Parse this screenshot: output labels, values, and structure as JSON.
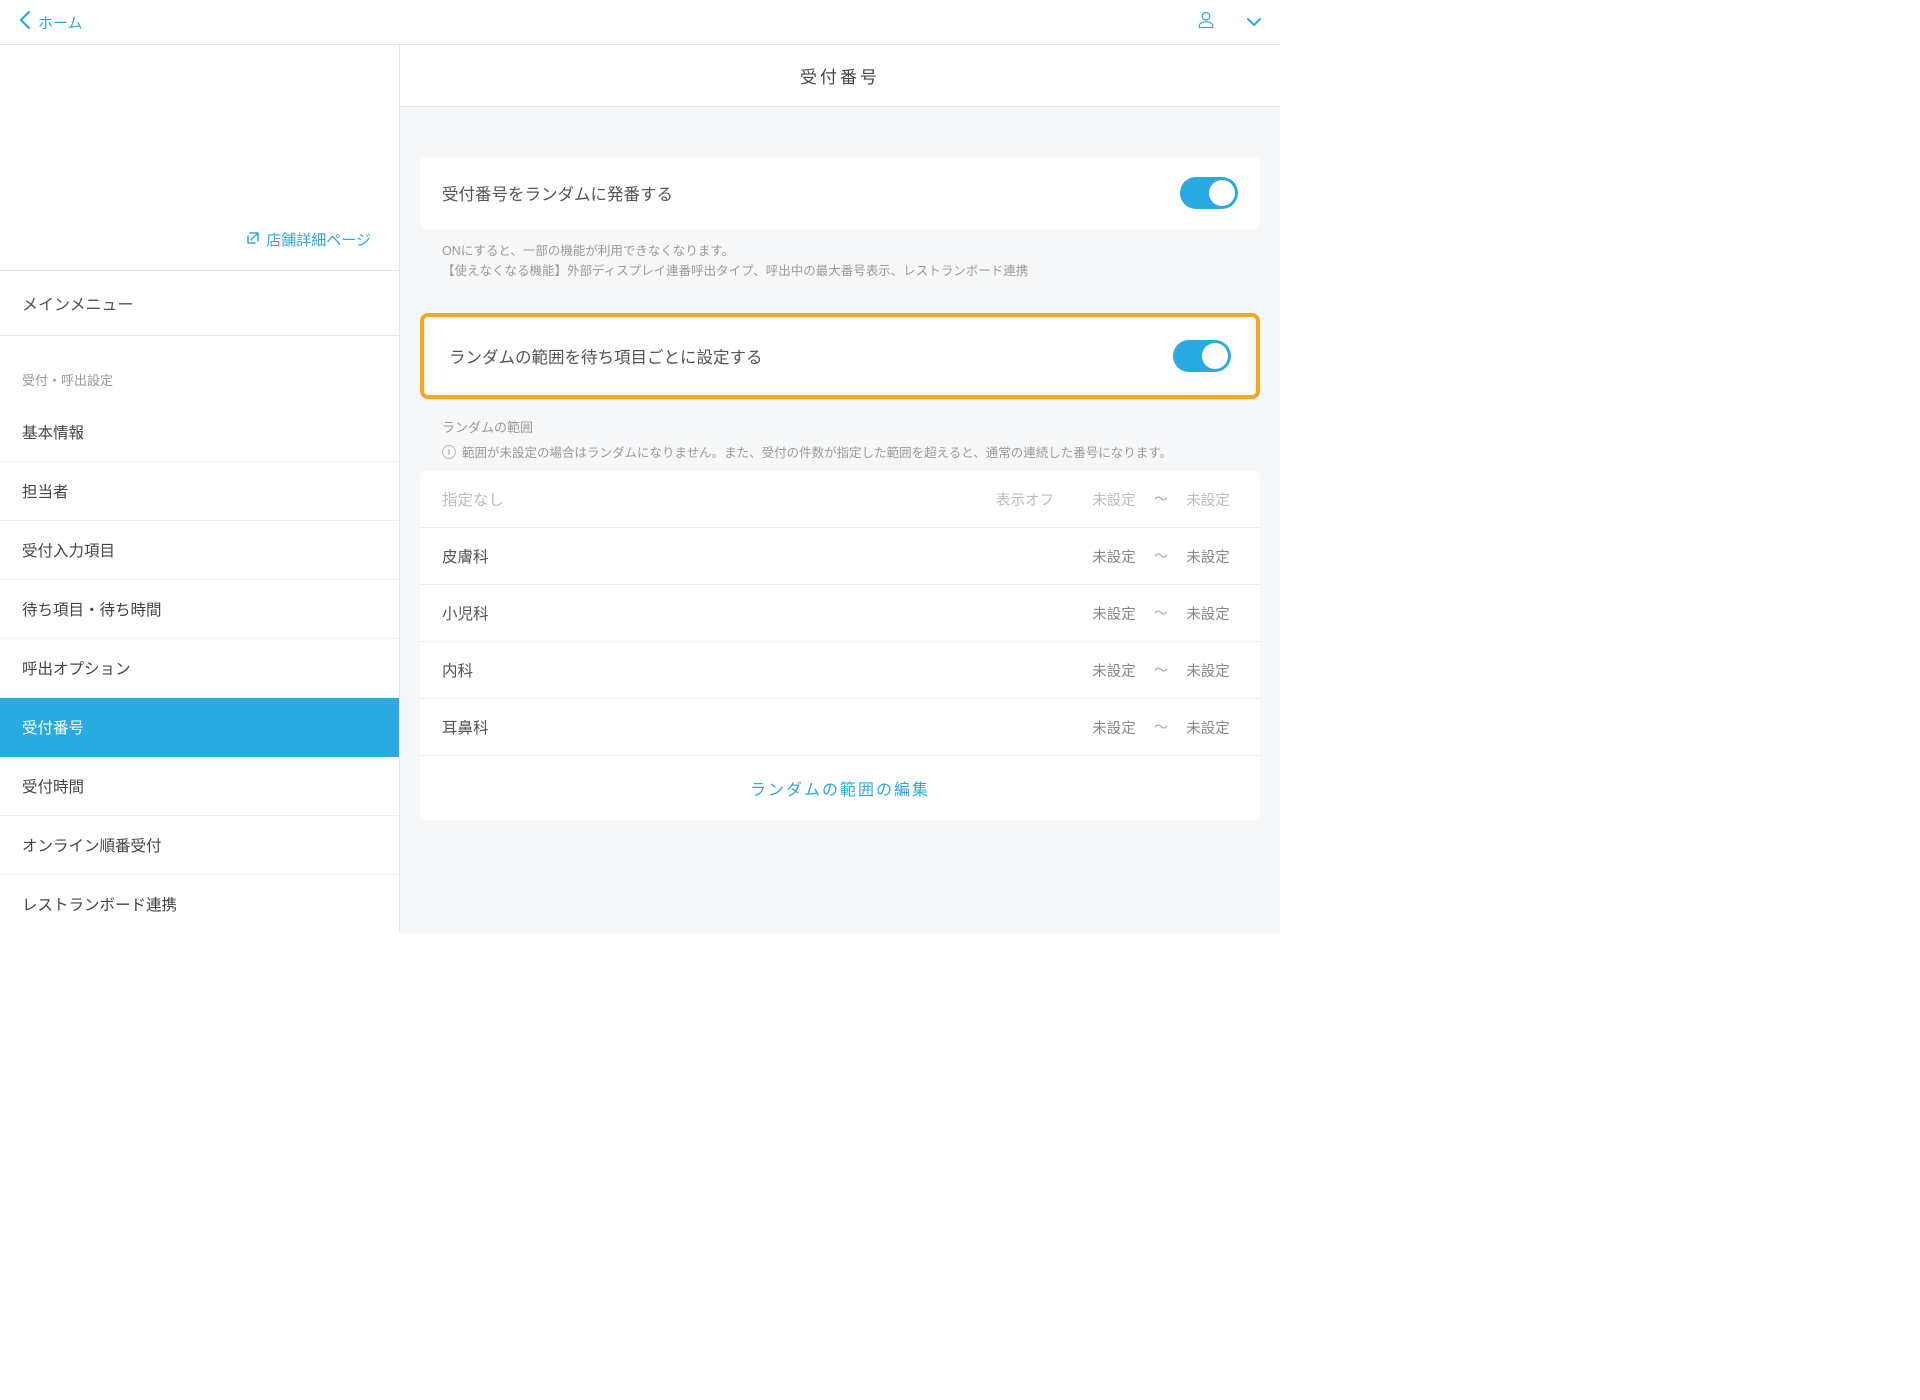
{
  "topbar": {
    "back_label": "ホーム"
  },
  "sidebar": {
    "store_link_label": "店舗詳細ページ",
    "main_menu_label": "メインメニュー",
    "section_label": "受付・呼出設定",
    "items": [
      {
        "label": "基本情報"
      },
      {
        "label": "担当者"
      },
      {
        "label": "受付入力項目"
      },
      {
        "label": "待ち項目・待ち時間"
      },
      {
        "label": "呼出オプション"
      },
      {
        "label": "受付番号",
        "active": true
      },
      {
        "label": "受付時間"
      },
      {
        "label": "オンライン順番受付"
      },
      {
        "label": "レストランボード連携"
      }
    ]
  },
  "main": {
    "title": "受付番号",
    "toggle1_label": "受付番号をランダムに発番する",
    "toggle1_help_line1": "ONにすると、一部の機能が利用できなくなります。",
    "toggle1_help_line2": "【使えなくなる機能】外部ディスプレイ連番呼出タイプ、呼出中の最大番号表示、レストランボード連携",
    "toggle2_label": "ランダムの範囲を待ち項目ごとに設定する",
    "range_head": "ランダムの範囲",
    "range_note": "範囲が未設定の場合はランダムになりません。また、受付の件数が指定した範囲を超えると、通常の連続した番号になります。",
    "display_off_label": "表示オフ",
    "unset_label": "未設定",
    "tilde": "〜",
    "rows": [
      {
        "name": "指定なし",
        "disabled": true,
        "show_off": true
      },
      {
        "name": "皮膚科"
      },
      {
        "name": "小児科"
      },
      {
        "name": "内科"
      },
      {
        "name": "耳鼻科"
      }
    ],
    "edit_link_label": "ランダムの範囲の編集"
  }
}
